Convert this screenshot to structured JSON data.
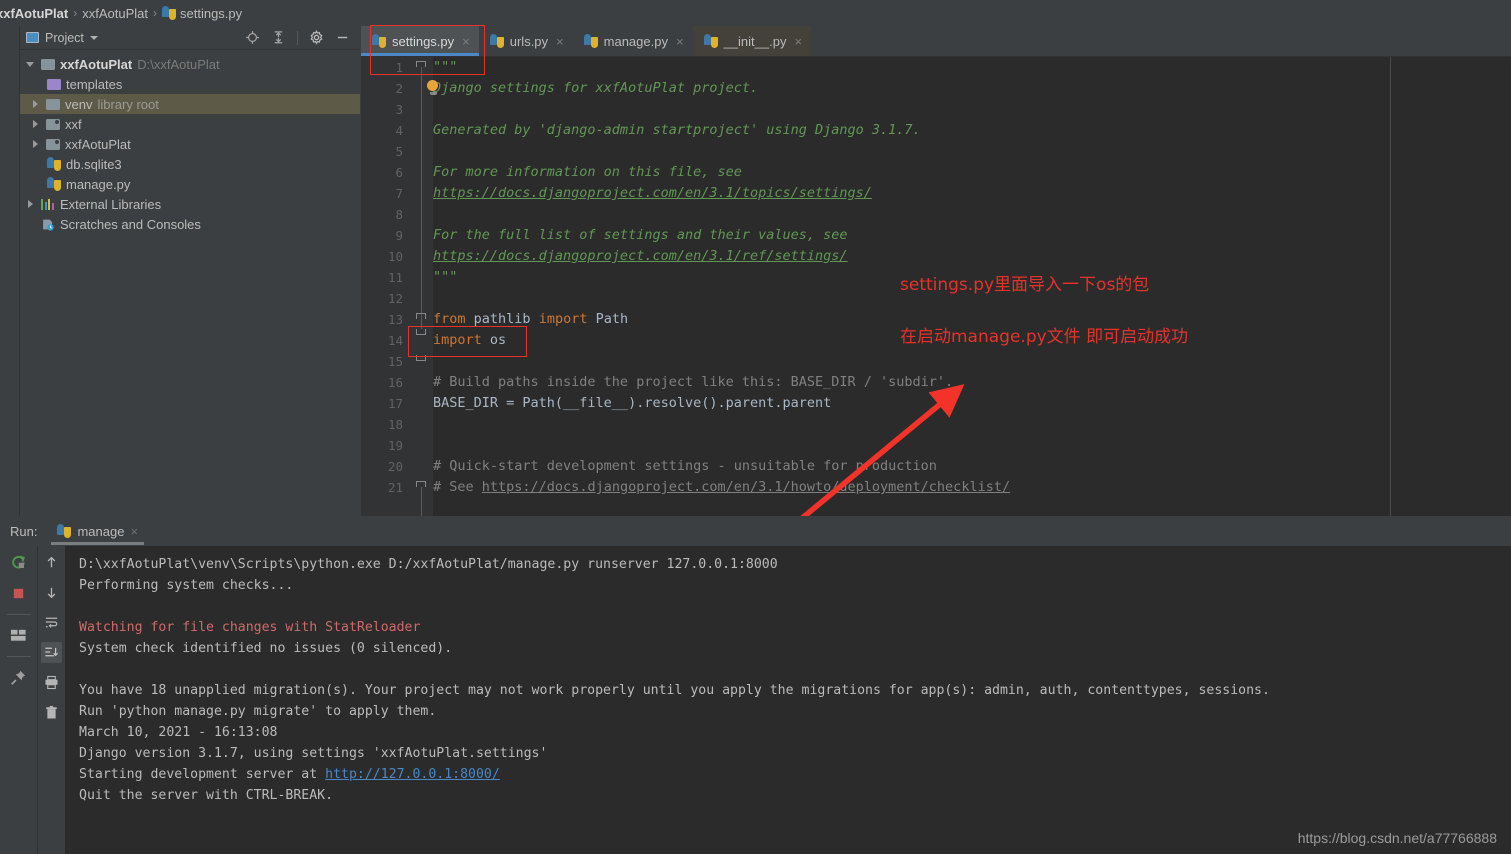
{
  "breadcrumb": {
    "items": [
      "xxfAotuPlat",
      "xxfAotuPlat",
      "settings.py"
    ],
    "sep": "›"
  },
  "project_panel": {
    "title": "Project",
    "icons": [
      "locate-icon",
      "collapse-all-icon",
      "gear-icon",
      "hide-icon"
    ],
    "tree": [
      {
        "label": "xxfAotuPlat",
        "suffix": "D:\\xxfAotuPlat",
        "kind": "project-root",
        "arrow": "down",
        "depth": 0,
        "selected": false
      },
      {
        "label": "templates",
        "suffix": "",
        "kind": "folder-templates",
        "arrow": "none",
        "depth": 1,
        "selected": false
      },
      {
        "label": "venv",
        "suffix": "library root",
        "kind": "folder",
        "arrow": "right",
        "depth": 1,
        "selected": true
      },
      {
        "label": "xxf",
        "suffix": "",
        "kind": "module",
        "arrow": "right",
        "depth": 1,
        "selected": false
      },
      {
        "label": "xxfAotuPlat",
        "suffix": "",
        "kind": "module",
        "arrow": "right",
        "depth": 1,
        "selected": false
      },
      {
        "label": "db.sqlite3",
        "suffix": "",
        "kind": "db-file",
        "arrow": "none",
        "depth": 1,
        "selected": false
      },
      {
        "label": "manage.py",
        "suffix": "",
        "kind": "py-file",
        "arrow": "none",
        "depth": 1,
        "selected": false
      },
      {
        "label": "External Libraries",
        "suffix": "",
        "kind": "libraries",
        "arrow": "right",
        "depth": 0,
        "selected": false
      },
      {
        "label": "Scratches and Consoles",
        "suffix": "",
        "kind": "scratches",
        "arrow": "none",
        "depth": 0,
        "selected": false
      }
    ]
  },
  "editor": {
    "tabs": [
      {
        "label": "settings.py",
        "active": true,
        "dim": false
      },
      {
        "label": "urls.py",
        "active": false,
        "dim": false
      },
      {
        "label": "manage.py",
        "active": false,
        "dim": false
      },
      {
        "label": "__init__.py",
        "active": false,
        "dim": true
      }
    ],
    "close_glyph": "×",
    "lines": [
      {
        "n": "1",
        "html": "<span class='c-doc'>\"\"\"</span>"
      },
      {
        "n": "2",
        "html": "<span class='c-doc'>Django settings for xxfAotuPlat project.</span>"
      },
      {
        "n": "3",
        "html": ""
      },
      {
        "n": "4",
        "html": "<span class='c-doc'>Generated by 'django-admin startproject' using Django 3.1.7.</span>"
      },
      {
        "n": "5",
        "html": ""
      },
      {
        "n": "6",
        "html": "<span class='c-doc'>For more information on this file, see</span>"
      },
      {
        "n": "7",
        "html": "<span class='c-docl'>https://docs.djangoproject.com/en/3.1/topics/settings/</span>"
      },
      {
        "n": "8",
        "html": ""
      },
      {
        "n": "9",
        "html": "<span class='c-doc'>For the full list of settings and their values, see</span>"
      },
      {
        "n": "10",
        "html": "<span class='c-docl'>https://docs.djangoproject.com/en/3.1/ref/settings/</span>"
      },
      {
        "n": "11",
        "html": "<span class='c-doc'>\"\"\"</span>"
      },
      {
        "n": "12",
        "html": ""
      },
      {
        "n": "13",
        "html": "<span class='c-kw'>from</span> <span class='c-id'>pathlib</span> <span class='c-kw'>import</span> <span class='c-id'>Path</span>"
      },
      {
        "n": "14",
        "html": "<span class='c-kw'>import</span> <span class='c-id'>os</span>"
      },
      {
        "n": "15",
        "html": ""
      },
      {
        "n": "16",
        "html": "<span class='c-cmt'># Build paths inside the project like this: BASE_DIR / 'subdir'.</span>"
      },
      {
        "n": "17",
        "html": "<span class='c-id'>BASE_DIR = Path(__file__).resolve().parent.parent</span>"
      },
      {
        "n": "18",
        "html": ""
      },
      {
        "n": "19",
        "html": ""
      },
      {
        "n": "20",
        "html": "<span class='c-cmt'># Quick-start development settings - unsuitable for production</span>"
      },
      {
        "n": "21",
        "html": "<span class='c-cmt'># See </span><span class='c-cmtl'>https://docs.djangoproject.com/en/3.1/howto/deployment/checklist/</span>"
      }
    ]
  },
  "annotations": {
    "line1": "settings.py里面导入一下os的包",
    "line2": "在启动manage.py文件  即可启动成功",
    "color": "#e5332a"
  },
  "run_panel": {
    "label": "Run:",
    "tab": "manage",
    "close_glyph": "×",
    "tools": [
      "rerun-icon",
      "stop-icon",
      "layout-icon",
      "pin-icon"
    ],
    "tools2": [
      "arrow-up-icon",
      "arrow-down-icon",
      "soft-wrap-icon",
      "scroll-to-end-icon",
      "print-icon",
      "trash-icon"
    ],
    "console": [
      {
        "text": "D:\\xxfAotuPlat\\venv\\Scripts\\python.exe D:/xxfAotuPlat/manage.py runserver 127.0.0.1:8000",
        "style": "normal"
      },
      {
        "text": "Performing system checks...",
        "style": "normal"
      },
      {
        "text": "",
        "style": "normal"
      },
      {
        "text": "Watching for file changes with StatReloader",
        "style": "error"
      },
      {
        "text": "System check identified no issues (0 silenced).",
        "style": "normal"
      },
      {
        "text": "",
        "style": "normal"
      },
      {
        "text": "You have 18 unapplied migration(s). Your project may not work properly until you apply the migrations for app(s): admin, auth, contenttypes, sessions.",
        "style": "normal"
      },
      {
        "text": "Run 'python manage.py migrate' to apply them.",
        "style": "normal"
      },
      {
        "text": "March 10, 2021 - 16:13:08",
        "style": "normal"
      },
      {
        "text": "Django version 3.1.7, using settings 'xxfAotuPlat.settings'",
        "style": "normal"
      },
      {
        "text": "Starting development server at ",
        "link": "http://127.0.0.1:8000/",
        "style": "link"
      },
      {
        "text": "Quit the server with CTRL-BREAK.",
        "style": "normal"
      }
    ]
  },
  "watermark": "https://blog.csdn.net/a77766888"
}
